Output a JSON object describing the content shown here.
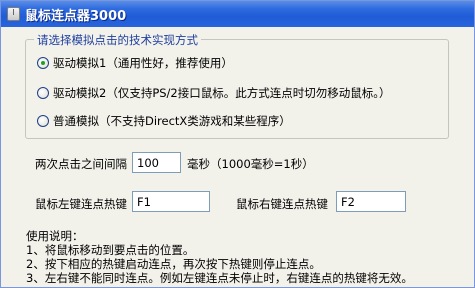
{
  "window": {
    "title": "鼠标连点器3000"
  },
  "method_group": {
    "legend": "请选择模拟点击的技术实现方式",
    "options": [
      {
        "label": "驱动模拟1（通用性好，推荐使用）",
        "checked": true
      },
      {
        "label": "驱动模拟2（仅支持PS/2接口鼠标。此方式连点时切勿移动鼠标。）",
        "checked": false
      },
      {
        "label": "普通模拟（不支持DirectX类游戏和某些程序）",
        "checked": false
      }
    ]
  },
  "interval": {
    "label": "两次点击之间间隔",
    "value": "100",
    "unit": "毫秒（1000毫秒=1秒）"
  },
  "hotkeys": {
    "left_label": "鼠标左键连点热键",
    "left_value": "F1",
    "right_label": "鼠标右键连点热键",
    "right_value": "F2"
  },
  "help": {
    "title": "使用说明：",
    "lines": [
      "1、将鼠标移动到要点击的位置。",
      "2、按下相应的热键启动连点，再次按下热键则停止连点。",
      "3、左右键不能同时连点。例如左键连点未停止时，右键连点的热键将无效。"
    ]
  }
}
